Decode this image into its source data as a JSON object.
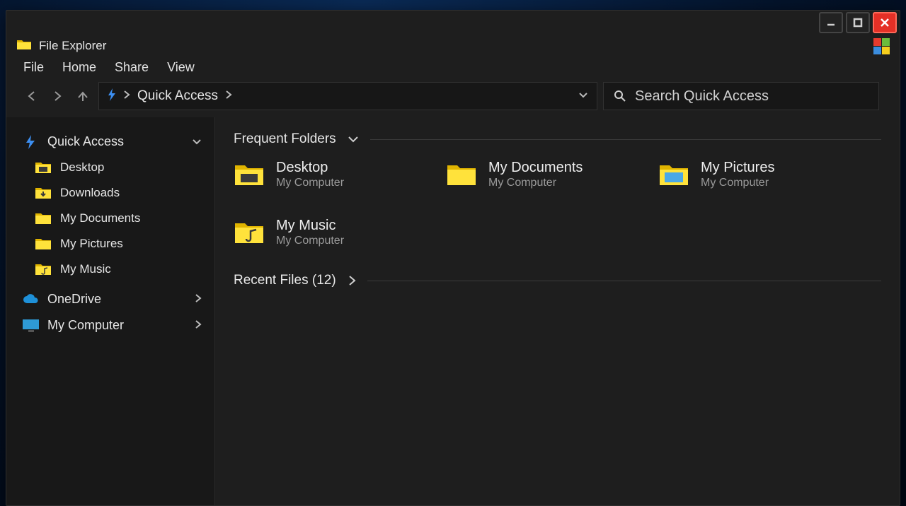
{
  "app": {
    "title": "File Explorer"
  },
  "menu": {
    "file": "File",
    "home": "Home",
    "share": "Share",
    "view": "View"
  },
  "address": {
    "crumb": "Quick Access"
  },
  "search": {
    "placeholder": "Search Quick Access"
  },
  "sidebar": {
    "quick_access": "Quick Access",
    "items": [
      "Desktop",
      "Downloads",
      "My Documents",
      "My Pictures",
      "My Music"
    ],
    "onedrive": "OneDrive",
    "my_computer": "My Computer"
  },
  "sections": {
    "frequent": "Frequent Folders",
    "recent": "Recent Files (12)"
  },
  "folders": [
    {
      "name": "Desktop",
      "loc": "My Computer",
      "icon": "desktop"
    },
    {
      "name": "My Documents",
      "loc": "My Computer",
      "icon": "plain"
    },
    {
      "name": "My Pictures",
      "loc": "My Computer",
      "icon": "pictures"
    },
    {
      "name": "My Music",
      "loc": "My Computer",
      "icon": "music"
    }
  ]
}
